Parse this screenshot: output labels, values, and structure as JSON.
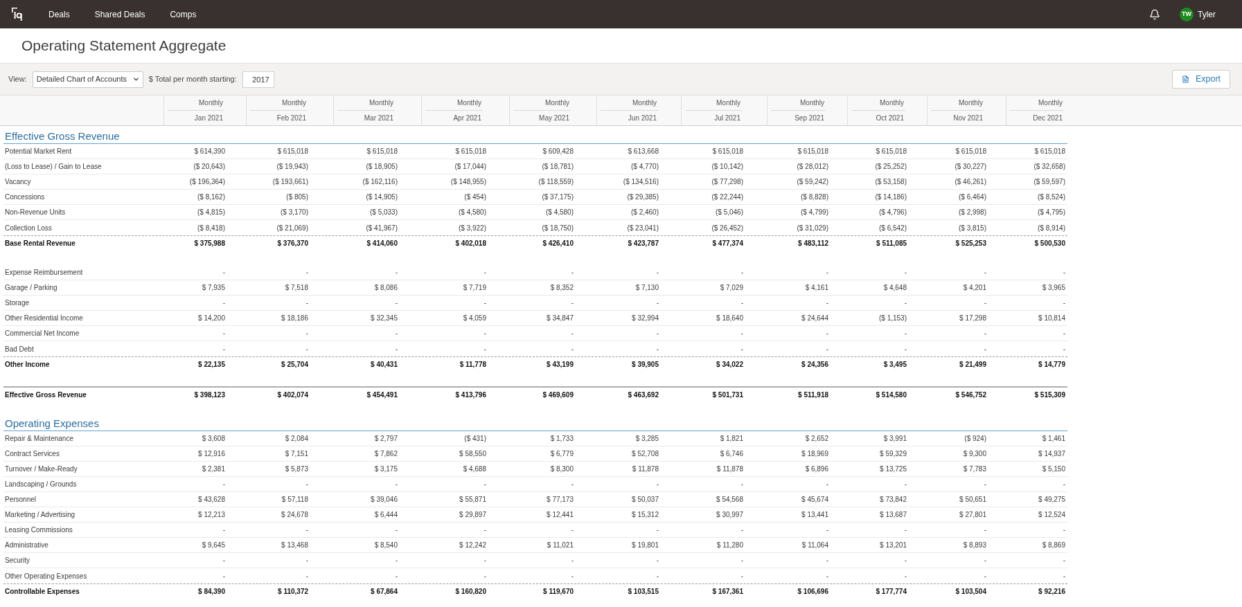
{
  "top_nav": {
    "links": [
      {
        "label": "Deals"
      },
      {
        "label": "Shared Deals"
      },
      {
        "label": "Comps"
      }
    ],
    "user": {
      "initials": "TW",
      "name": "Tyler"
    }
  },
  "page_title": "Operating Statement Aggregate",
  "toolbar": {
    "view_label": "View:",
    "view_select": "Detailed Chart of Accounts",
    "start_label": "$ Total per month starting:",
    "start_year": "2017",
    "export_button": "Export"
  },
  "table": {
    "columns": [
      {
        "period": "Monthly",
        "month": "Jan 2021"
      },
      {
        "period": "Monthly",
        "month": "Feb 2021"
      },
      {
        "period": "Monthly",
        "month": "Mar 2021"
      },
      {
        "period": "Monthly",
        "month": "Apr 2021"
      },
      {
        "period": "Monthly",
        "month": "May 2021"
      },
      {
        "period": "Monthly",
        "month": "Jun 2021"
      },
      {
        "period": "Monthly",
        "month": "Jul 2021"
      },
      {
        "period": "Monthly",
        "month": "Sep 2021"
      },
      {
        "period": "Monthly",
        "month": "Oct 2021"
      },
      {
        "period": "Monthly",
        "month": "Nov 2021"
      },
      {
        "period": "Monthly",
        "month": "Dec 2021"
      }
    ],
    "sections": [
      {
        "title": "Effective Gross Revenue",
        "groups": [
          {
            "rows": [
              {
                "kind": "item",
                "label": "Potential Market Rent",
                "values": [
                  "$ 614,390",
                  "$ 615,018",
                  "$ 615,018",
                  "$ 615,018",
                  "$ 609,428",
                  "$ 613,668",
                  "$ 615,018",
                  "$ 615,018",
                  "$ 615,018",
                  "$ 615,018",
                  "$ 615,018"
                ]
              },
              {
                "kind": "item",
                "label": "(Loss to Lease) / Gain to Lease",
                "values": [
                  "($ 20,643)",
                  "($ 19,943)",
                  "($ 18,905)",
                  "($ 17,044)",
                  "($ 18,781)",
                  "($ 4,770)",
                  "($ 10,142)",
                  "($ 28,012)",
                  "($ 25,252)",
                  "($ 30,227)",
                  "($ 32,658)"
                ]
              },
              {
                "kind": "item",
                "label": "Vacancy",
                "values": [
                  "($ 196,364)",
                  "($ 193,661)",
                  "($ 162,116)",
                  "($ 148,955)",
                  "($ 118,559)",
                  "($ 134,516)",
                  "($ 77,298)",
                  "($ 59,242)",
                  "($ 53,158)",
                  "($ 46,261)",
                  "($ 59,597)"
                ]
              },
              {
                "kind": "item",
                "label": "Concessions",
                "values": [
                  "($ 8,162)",
                  "($ 805)",
                  "($ 14,905)",
                  "($ 454)",
                  "($ 37,175)",
                  "($ 29,385)",
                  "($ 22,244)",
                  "($ 8,828)",
                  "($ 14,186)",
                  "($ 6,464)",
                  "($ 8,524)"
                ]
              },
              {
                "kind": "item",
                "label": "Non-Revenue Units",
                "values": [
                  "($ 4,815)",
                  "($ 3,170)",
                  "($ 5,033)",
                  "($ 4,580)",
                  "($ 4,580)",
                  "($ 2,460)",
                  "($ 5,046)",
                  "($ 4,799)",
                  "($ 4,796)",
                  "($ 2,998)",
                  "($ 4,795)"
                ]
              },
              {
                "kind": "item",
                "label": "Collection Loss",
                "values": [
                  "($ 8,418)",
                  "($ 21,069)",
                  "($ 41,967)",
                  "($ 3,922)",
                  "($ 18,750)",
                  "($ 23,041)",
                  "($ 26,452)",
                  "($ 31,029)",
                  "($ 6,542)",
                  "($ 3,815)",
                  "($ 8,914)"
                ]
              },
              {
                "kind": "subtotal",
                "label": "Base Rental Revenue",
                "values": [
                  "$ 375,988",
                  "$ 376,370",
                  "$ 414,060",
                  "$ 402,018",
                  "$ 426,410",
                  "$ 423,787",
                  "$ 477,374",
                  "$ 483,112",
                  "$ 511,085",
                  "$ 525,253",
                  "$ 500,530"
                ]
              }
            ]
          },
          {
            "rows": [
              {
                "kind": "item",
                "label": "Expense Reimbursement",
                "values": [
                  "-",
                  "-",
                  "-",
                  "-",
                  "-",
                  "-",
                  "-",
                  "-",
                  "-",
                  "-",
                  "-"
                ]
              },
              {
                "kind": "item",
                "label": "Garage / Parking",
                "values": [
                  "$ 7,935",
                  "$ 7,518",
                  "$ 8,086",
                  "$ 7,719",
                  "$ 8,352",
                  "$ 7,130",
                  "$ 7,029",
                  "$ 4,161",
                  "$ 4,648",
                  "$ 4,201",
                  "$ 3,965"
                ]
              },
              {
                "kind": "item",
                "label": "Storage",
                "values": [
                  "-",
                  "-",
                  "-",
                  "-",
                  "-",
                  "-",
                  "-",
                  "-",
                  "-",
                  "-",
                  "-"
                ]
              },
              {
                "kind": "item",
                "label": "Other Residential Income",
                "values": [
                  "$ 14,200",
                  "$ 18,186",
                  "$ 32,345",
                  "$ 4,059",
                  "$ 34,847",
                  "$ 32,994",
                  "$ 18,640",
                  "$ 24,644",
                  "($ 1,153)",
                  "$ 17,298",
                  "$ 10,814"
                ]
              },
              {
                "kind": "item",
                "label": "Commercial Net Income",
                "values": [
                  "-",
                  "-",
                  "-",
                  "-",
                  "-",
                  "-",
                  "-",
                  "-",
                  "-",
                  "-",
                  "-"
                ]
              },
              {
                "kind": "item",
                "label": "Bad Debt",
                "values": [
                  "-",
                  "-",
                  "-",
                  "-",
                  "-",
                  "-",
                  "-",
                  "-",
                  "-",
                  "-",
                  "-"
                ]
              },
              {
                "kind": "subtotal",
                "label": "Other Income",
                "values": [
                  "$ 22,135",
                  "$ 25,704",
                  "$ 40,431",
                  "$ 11,778",
                  "$ 43,199",
                  "$ 39,905",
                  "$ 34,022",
                  "$ 24,356",
                  "$ 3,495",
                  "$ 21,499",
                  "$ 14,779"
                ]
              }
            ]
          },
          {
            "rows": [
              {
                "kind": "total",
                "label": "Effective Gross Revenue",
                "values": [
                  "$ 398,123",
                  "$ 402,074",
                  "$ 454,491",
                  "$ 413,796",
                  "$ 469,609",
                  "$ 463,692",
                  "$ 501,731",
                  "$ 511,918",
                  "$ 514,580",
                  "$ 546,752",
                  "$ 515,309"
                ]
              }
            ]
          }
        ]
      },
      {
        "title": "Operating Expenses",
        "groups": [
          {
            "rows": [
              {
                "kind": "item",
                "label": "Repair & Maintenance",
                "values": [
                  "$ 3,608",
                  "$ 2,084",
                  "$ 2,797",
                  "($ 431)",
                  "$ 1,733",
                  "$ 3,285",
                  "$ 1,821",
                  "$ 2,652",
                  "$ 3,991",
                  "($ 924)",
                  "$ 1,461"
                ]
              },
              {
                "kind": "item",
                "label": "Contract Services",
                "values": [
                  "$ 12,916",
                  "$ 7,151",
                  "$ 7,862",
                  "$ 58,550",
                  "$ 6,779",
                  "$ 52,708",
                  "$ 6,746",
                  "$ 18,969",
                  "$ 59,329",
                  "$ 9,300",
                  "$ 14,937"
                ]
              },
              {
                "kind": "item",
                "label": "Turnover / Make-Ready",
                "values": [
                  "$ 2,381",
                  "$ 5,873",
                  "$ 3,175",
                  "$ 4,688",
                  "$ 8,300",
                  "$ 11,878",
                  "$ 11,878",
                  "$ 6,896",
                  "$ 13,725",
                  "$ 7,783",
                  "$ 5,150"
                ]
              },
              {
                "kind": "item",
                "label": "Landscaping / Grounds",
                "values": [
                  "-",
                  "-",
                  "-",
                  "-",
                  "-",
                  "-",
                  "-",
                  "-",
                  "-",
                  "-",
                  "-"
                ]
              },
              {
                "kind": "item",
                "label": "Personnel",
                "values": [
                  "$ 43,628",
                  "$ 57,118",
                  "$ 39,046",
                  "$ 55,871",
                  "$ 77,173",
                  "$ 50,037",
                  "$ 54,568",
                  "$ 45,674",
                  "$ 73,842",
                  "$ 50,651",
                  "$ 49,275"
                ]
              },
              {
                "kind": "item",
                "label": "Marketing / Advertising",
                "values": [
                  "$ 12,213",
                  "$ 24,678",
                  "$ 6,444",
                  "$ 29,897",
                  "$ 12,441",
                  "$ 15,312",
                  "$ 30,997",
                  "$ 13,441",
                  "$ 13,687",
                  "$ 27,801",
                  "$ 12,524"
                ]
              },
              {
                "kind": "item",
                "label": "Leasing Commissions",
                "values": [
                  "-",
                  "-",
                  "-",
                  "-",
                  "-",
                  "-",
                  "-",
                  "-",
                  "-",
                  "-",
                  "-"
                ]
              },
              {
                "kind": "item",
                "label": "Administrative",
                "values": [
                  "$ 9,645",
                  "$ 13,468",
                  "$ 8,540",
                  "$ 12,242",
                  "$ 11,021",
                  "$ 19,801",
                  "$ 11,280",
                  "$ 11,064",
                  "$ 13,201",
                  "$ 8,893",
                  "$ 8,869"
                ]
              },
              {
                "kind": "item",
                "label": "Security",
                "values": [
                  "-",
                  "-",
                  "-",
                  "-",
                  "-",
                  "-",
                  "-",
                  "-",
                  "-",
                  "-",
                  "-"
                ]
              },
              {
                "kind": "item",
                "label": "Other Operating Expenses",
                "values": [
                  "-",
                  "-",
                  "-",
                  "-",
                  "-",
                  "-",
                  "-",
                  "-",
                  "-",
                  "-",
                  "-"
                ]
              },
              {
                "kind": "subtotal",
                "label": "Controllable Expenses",
                "values": [
                  "$ 84,390",
                  "$ 110,372",
                  "$ 67,864",
                  "$ 160,820",
                  "$ 119,670",
                  "$ 103,515",
                  "$ 167,361",
                  "$ 106,696",
                  "$ 177,774",
                  "$ 103,504",
                  "$ 92,216"
                ]
              }
            ]
          }
        ]
      }
    ]
  }
}
